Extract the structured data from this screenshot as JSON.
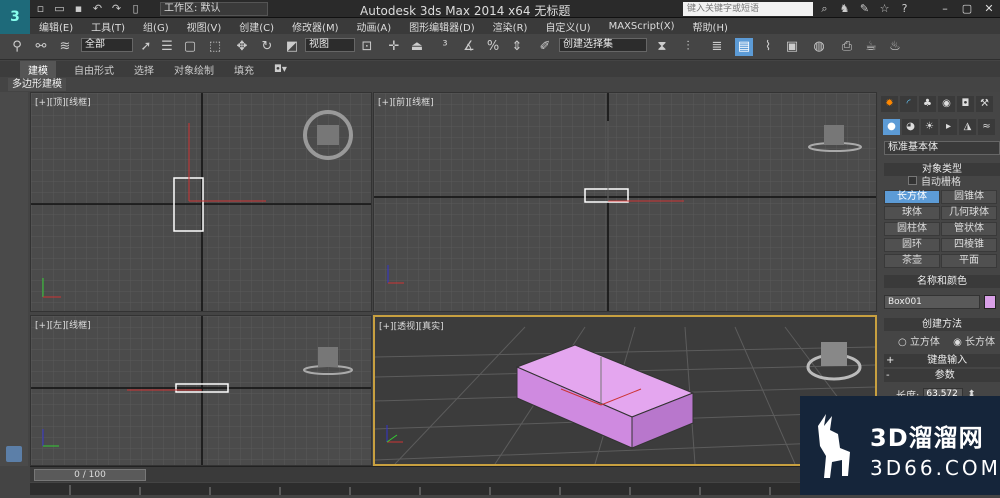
{
  "titlebar": {
    "workspace_label": "工作区: 默认",
    "title": "Autodesk 3ds Max  2014 x64      无标题",
    "search_placeholder": "键入关键字或短语"
  },
  "menu": [
    "编辑(E)",
    "工具(T)",
    "组(G)",
    "视图(V)",
    "创建(C)",
    "修改器(M)",
    "动画(A)",
    "图形编辑器(D)",
    "渲染(R)",
    "自定义(U)",
    "MAXScript(X)",
    "帮助(H)"
  ],
  "toolbar": {
    "filter_value": "全部",
    "refcoord_value": "视图",
    "named_sel_value": "创建选择集"
  },
  "ribbon": {
    "tabs": [
      "建模",
      "自由形式",
      "选择",
      "对象绘制",
      "填充"
    ],
    "sub_label": "多边形建模"
  },
  "viewports": [
    {
      "label": "[+][顶][线框]"
    },
    {
      "label": "[+][前][线框]"
    },
    {
      "label": "[+][左][线框]"
    },
    {
      "label": "[+][透视][真实]"
    }
  ],
  "panel": {
    "dropdown_value": "标准基本体",
    "section_object_type": "对象类型",
    "autogrid_label": "自动栅格",
    "buttons": [
      "长方体",
      "圆锥体",
      "球体",
      "几何球体",
      "圆柱体",
      "管状体",
      "圆环",
      "四棱锥",
      "茶壶",
      "平面"
    ],
    "active_button": "长方体",
    "section_name_color": "名称和颜色",
    "object_name": "Box001",
    "object_color": "#d9a0e8",
    "section_create_method": "创建方法",
    "radio_cube": "立方体",
    "radio_box": "长方体",
    "section_keyboard": "键盘输入",
    "section_params": "参数",
    "length_label": "长度:",
    "length_value": "63.572"
  },
  "timeline": {
    "frame_text": "0 / 100"
  },
  "watermark": {
    "logo_text": "3D溜溜网",
    "url": "3D66.COM"
  },
  "colors": {
    "accent": "#5c9bd6",
    "box": "#d9a0e8",
    "active_vp_border": "#c8a040"
  }
}
